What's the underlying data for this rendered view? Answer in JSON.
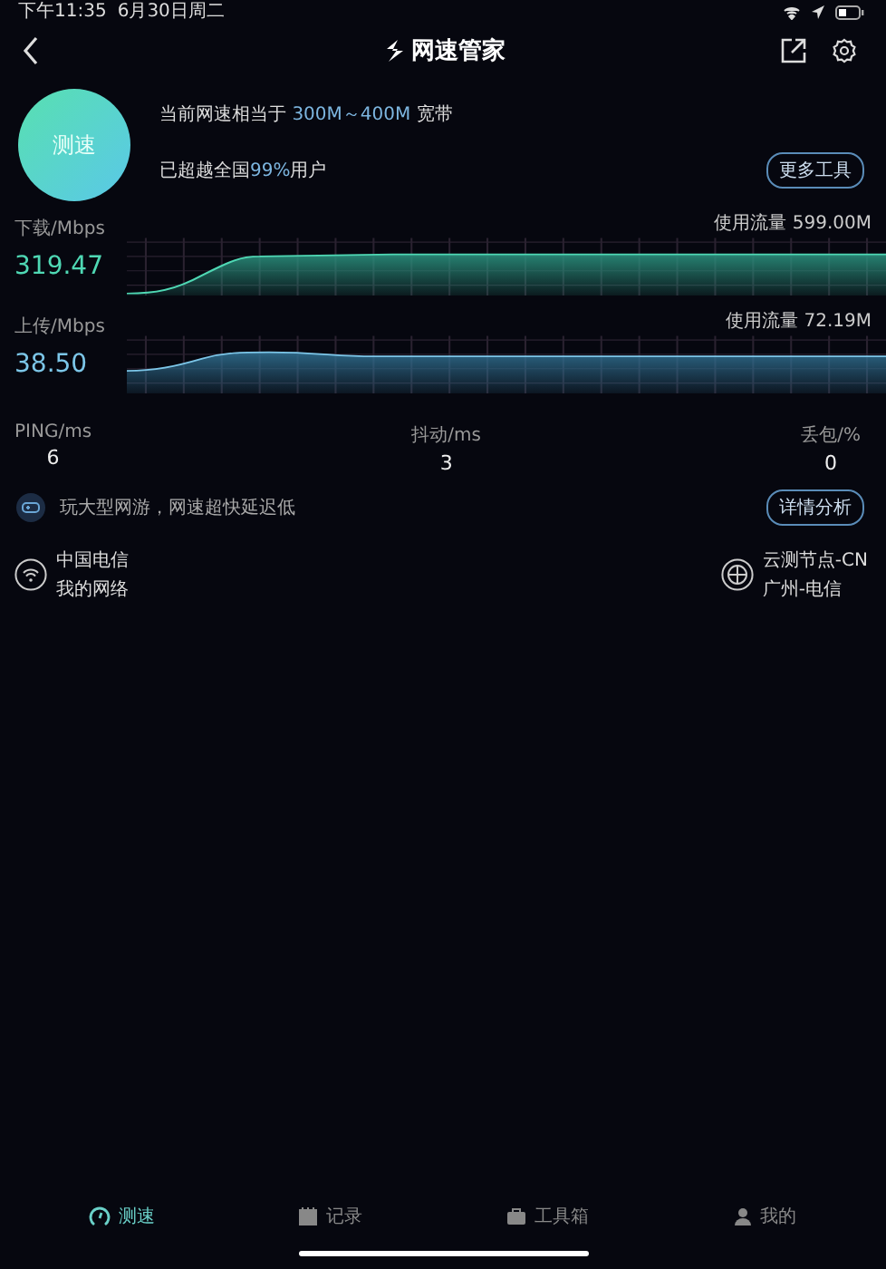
{
  "status_bar": {
    "time": "下午11:35",
    "date": "6月30日周二"
  },
  "header": {
    "title": "网速管家"
  },
  "summary": {
    "button": "测速",
    "equivalent_prefix": "当前网速相当于",
    "equivalent_value": "300M～400M",
    "equivalent_suffix": "宽带",
    "rank_prefix": "已超越全国",
    "rank_value": "99%",
    "rank_suffix": "用户",
    "more_tools": "更多工具"
  },
  "speeds": [
    {
      "kind": "download",
      "label": "下载/Mbps",
      "value": "319.47",
      "usage": "使用流量 599.00M"
    },
    {
      "kind": "upload",
      "label": "上传/Mbps",
      "value": "38.50",
      "usage": "使用流量 72.19M"
    }
  ],
  "stats": [
    {
      "label": "PING/ms",
      "value": "6"
    },
    {
      "label": "抖动/ms",
      "value": "3"
    },
    {
      "label": "丢包/%",
      "value": "0"
    }
  ],
  "tip": {
    "text": "玩大型网游，网速超快延迟低",
    "button": "详情分析"
  },
  "network": {
    "carrier": "中国电信",
    "carrier_sub": "我的网络",
    "node": "云测节点-CN",
    "node_sub": "广州-电信"
  },
  "tabs": [
    {
      "label": "测速",
      "selected": true
    },
    {
      "label": "记录",
      "selected": false
    },
    {
      "label": "工具箱",
      "selected": false
    },
    {
      "label": "我的",
      "selected": false
    }
  ]
}
